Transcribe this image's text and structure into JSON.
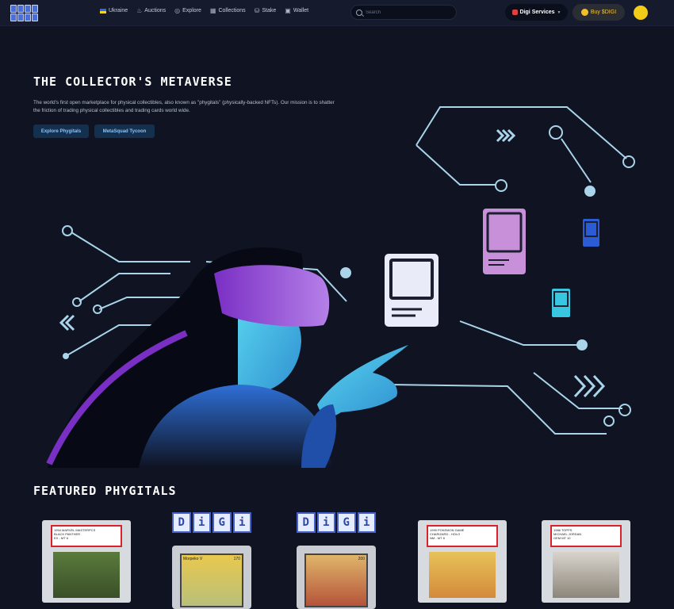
{
  "nav": {
    "items": [
      {
        "label": "Ukraine",
        "icon": "ukraine-flag-icon"
      },
      {
        "label": "Auctions",
        "icon": "flame-icon"
      },
      {
        "label": "Explore",
        "icon": "compass-icon"
      },
      {
        "label": "Collections",
        "icon": "grid-icon"
      },
      {
        "label": "Stake",
        "icon": "stake-icon"
      },
      {
        "label": "Wallet",
        "icon": "wallet-icon"
      }
    ],
    "search_placeholder": "Search",
    "digi_services": "Digi Services",
    "buy_label": "Buy $DIGI"
  },
  "hero": {
    "title": "THE COLLECTOR'S METAVERSE",
    "description": "The world's first open marketplace for physical collectibles, also known as \"phygitals\" (physically-backed NFTs). Our mission is to shatter the friction of trading physical collectibles and trading cards world wide.",
    "button_primary": "Explore Phygitals",
    "button_secondary": "MetaSquad Tycoon"
  },
  "featured": {
    "title": "FEATURED PHYGITALS",
    "cards": [
      {
        "label_line1": "1994 MARVEL MASTERPCS",
        "label_line2": "BLACK PANTHER",
        "grade": "EX - MT 6"
      },
      {
        "cube_letters": [
          "D",
          "i",
          "G",
          "i"
        ],
        "card_name": "Morpeko V",
        "hp": "170"
      },
      {
        "cube_letters": [
          "D",
          "i",
          "G",
          "i"
        ],
        "card_name": "",
        "hp": "200"
      },
      {
        "label_line1": "1999 POKEMON GAME",
        "label_line2": "CHARIZARD - HOLO",
        "grade": "NM - MT 8"
      },
      {
        "label_line1": "1986 TOPPS",
        "label_line2": "MICHAEL JORDAN",
        "grade": "GEM MT 10"
      }
    ]
  },
  "colors": {
    "background": "#0f1322",
    "accent_cyan": "#4bd7f0",
    "accent_purple": "#8a3fd1",
    "line": "#a9d4ea"
  }
}
